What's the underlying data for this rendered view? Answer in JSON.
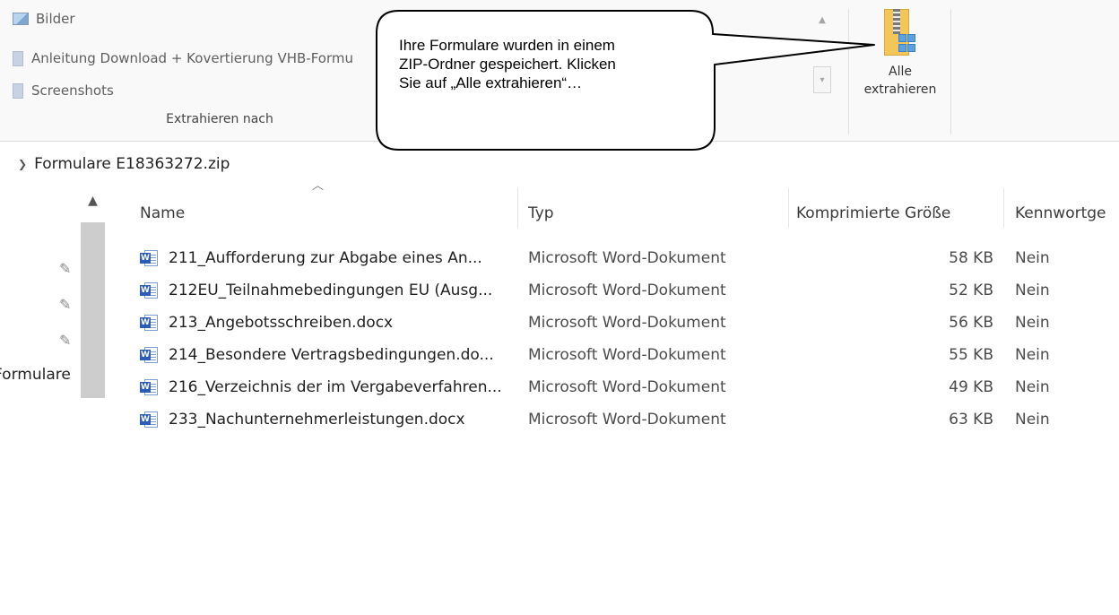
{
  "ribbon": {
    "destinations": [
      {
        "label": "Bilder",
        "icon": "pictures-icon"
      },
      {
        "label": "Anleitung Download + Kovertierung VHB-Formu",
        "icon": "folder-icon"
      },
      {
        "label": "Screenshots",
        "icon": "folder-icon"
      }
    ],
    "group_label": "Extrahieren nach",
    "extract_all": {
      "line1": "Alle",
      "line2": "extrahieren",
      "icon": "zip-folder-icon"
    }
  },
  "address": {
    "path": "Formulare E18363272.zip"
  },
  "nav": {
    "visible_label": "Formulare"
  },
  "columns": {
    "name": "Name",
    "type": "Typ",
    "size": "Komprimierte Größe",
    "password": "Kennwortge"
  },
  "files": [
    {
      "name": "211_Aufforderung zur Abgabe eines An...",
      "type": "Microsoft Word-Dokument",
      "size": "58 KB",
      "password": "Nein"
    },
    {
      "name": "212EU_Teilnahmebedingungen EU (Ausg...",
      "type": "Microsoft Word-Dokument",
      "size": "52 KB",
      "password": "Nein"
    },
    {
      "name": "213_Angebotsschreiben.docx",
      "type": "Microsoft Word-Dokument",
      "size": "56 KB",
      "password": "Nein"
    },
    {
      "name": "214_Besondere Vertragsbedingungen.do...",
      "type": "Microsoft Word-Dokument",
      "size": "55 KB",
      "password": "Nein"
    },
    {
      "name": "216_Verzeichnis der im Vergabeverfahren...",
      "type": "Microsoft Word-Dokument",
      "size": "49 KB",
      "password": "Nein"
    },
    {
      "name": "233_Nachunternehmerleistungen.docx",
      "type": "Microsoft Word-Dokument",
      "size": "63 KB",
      "password": "Nein"
    }
  ],
  "callout": {
    "text": "Ihre Formulare wurden in einem\nZIP-Ordner gespeichert. Klicken\nSie auf „Alle extrahieren“…"
  },
  "colors": {
    "ribbon_bg": "#f9f9f9",
    "scroll_thumb": "#cdcdcd",
    "word_blue": "#2b5cb8",
    "zip_yellow": "#f3c65a"
  }
}
